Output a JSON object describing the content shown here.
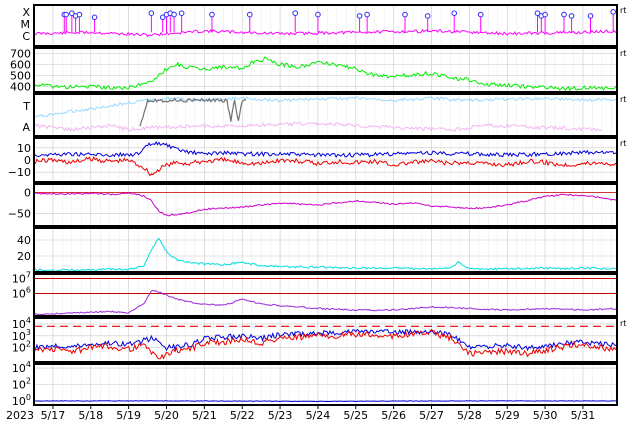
{
  "chart_data": {
    "type": "line",
    "x_axis": {
      "year_label": "2023",
      "ticks": [
        "5/17",
        "5/18",
        "5/19",
        "5/20",
        "5/21",
        "5/22",
        "5/23",
        "5/24",
        "5/25",
        "5/26",
        "5/27",
        "5/28",
        "5/29",
        "5/30",
        "5/31"
      ],
      "start_day": 16.5,
      "end_day": 31.9
    },
    "grid": true,
    "side_label": "rt",
    "panels": [
      {
        "id": "xray-flares",
        "type": "scatter",
        "ytick_labels": [
          "X",
          "M",
          "C"
        ],
        "ylim": [
          0,
          3
        ],
        "line_color": "#ff00ff",
        "marker_color": "#2a2aff",
        "flare_days": [
          17.3,
          17.35,
          17.5,
          17.6,
          17.7,
          18.1,
          19.6,
          19.9,
          20.0,
          20.1,
          20.2,
          20.4,
          21.2,
          22.2,
          23.4,
          24.0,
          25.1,
          25.3,
          26.3,
          26.9,
          27.6,
          28.3,
          29.8,
          29.9,
          30.0,
          30.5,
          30.7,
          31.2,
          31.8
        ],
        "flare_levels": [
          2.3,
          2.3,
          2.4,
          2.2,
          2.3,
          2.1,
          2.4,
          2.1,
          2.3,
          2.4,
          2.3,
          2.4,
          2.3,
          2.3,
          2.4,
          2.3,
          2.2,
          2.3,
          2.3,
          2.2,
          2.4,
          2.3,
          2.4,
          2.2,
          2.3,
          2.3,
          2.2,
          2.2,
          2.5
        ]
      },
      {
        "id": "solar-wind-speed",
        "ylim": [
          350,
          750
        ],
        "yticks": [
          400,
          500,
          600,
          700
        ],
        "series": [
          {
            "color": "#00ee00",
            "x": [
              16.5,
              17.0,
              17.5,
              18.0,
              18.5,
              19.0,
              19.5,
              19.8,
              20.0,
              20.3,
              20.6,
              21.0,
              21.5,
              22.0,
              22.3,
              22.6,
              23.0,
              23.5,
              24.0,
              24.5,
              25.0,
              25.5,
              26.0,
              26.5,
              27.0,
              27.5,
              28.0,
              28.5,
              29.0,
              29.5,
              30.0,
              30.5,
              31.0,
              31.5,
              31.9
            ],
            "y": [
              420,
              400,
              395,
              400,
              390,
              390,
              430,
              500,
              560,
              600,
              570,
              560,
              580,
              560,
              620,
              650,
              600,
              580,
              620,
              600,
              560,
              500,
              490,
              510,
              520,
              480,
              460,
              420,
              410,
              400,
              390,
              380,
              390,
              380,
              390
            ]
          }
        ]
      },
      {
        "id": "imf-sector",
        "ytick_labels": [
          "T",
          "A"
        ],
        "ylim": [
          0,
          1
        ],
        "series": [
          {
            "color": "#9ad8ff",
            "x": [
              16.5,
              19.5,
              20.0,
              21.0,
              22.0,
              23.0,
              24.0,
              25.0,
              26.0,
              27.0,
              28.0,
              29.0,
              30.0,
              31.0,
              31.9
            ],
            "y": [
              0.45,
              0.85,
              0.9,
              0.85,
              0.9,
              0.85,
              0.88,
              0.9,
              0.85,
              0.9,
              0.85,
              0.88,
              0.9,
              0.85,
              0.88
            ]
          },
          {
            "color": "#f2b6f2",
            "x": [
              16.5,
              17.0,
              17.5,
              18.0,
              18.5,
              19.0,
              19.5,
              22.0,
              24.0,
              26.0,
              27.5,
              28.5,
              30.0,
              31.5
            ],
            "y": [
              0.25,
              0.2,
              0.15,
              0.2,
              0.25,
              0.15,
              0.2,
              0.25,
              0.3,
              0.2,
              0.15,
              0.25,
              0.2,
              0.15
            ]
          },
          {
            "color": "#707070",
            "x": [
              19.3,
              19.5,
              19.55,
              21.6,
              21.7,
              21.8,
              21.9,
              22.0,
              22.1
            ],
            "y": [
              0.25,
              0.85,
              0.85,
              0.85,
              0.35,
              0.85,
              0.35,
              0.85,
              0.85
            ]
          }
        ]
      },
      {
        "id": "imf-bt-bz",
        "ylim": [
          -18,
          18
        ],
        "yticks": [
          -10,
          0,
          10
        ],
        "series": [
          {
            "color": "#0000dd",
            "x": [
              16.5,
              17.5,
              18.5,
              19.3,
              19.5,
              19.8,
              20.0,
              20.3,
              20.7,
              21.0,
              21.5,
              22.0,
              23.0,
              24.0,
              25.0,
              26.0,
              27.0,
              28.0,
              29.0,
              30.0,
              31.0,
              31.9
            ],
            "y": [
              4,
              5,
              4,
              5,
              12,
              14,
              12,
              8,
              6,
              5,
              6,
              5,
              5,
              4,
              4,
              5,
              6,
              5,
              4,
              5,
              6,
              6
            ]
          },
          {
            "color": "#ee0000",
            "x": [
              16.5,
              17.0,
              17.5,
              18.0,
              18.5,
              19.0,
              19.4,
              19.6,
              19.8,
              20.0,
              20.3,
              20.6,
              21.0,
              21.5,
              22.0,
              22.5,
              23.0,
              23.5,
              24.0,
              24.5,
              25.0,
              25.5,
              26.0,
              26.5,
              27.0,
              27.5,
              28.0,
              28.5,
              29.0,
              29.5,
              30.0,
              30.5,
              31.0,
              31.5,
              31.9
            ],
            "y": [
              -1,
              0,
              -2,
              1,
              -1,
              0,
              -6,
              -12,
              -8,
              -4,
              -2,
              -3,
              -1,
              0,
              -2,
              -3,
              0,
              -1,
              -3,
              -1,
              -2,
              -1,
              -4,
              -2,
              -1,
              -3,
              -2,
              -3,
              -4,
              -1,
              -2,
              -4,
              -3,
              -2,
              -4
            ]
          }
        ]
      },
      {
        "id": "dst-index",
        "ylim": [
          -80,
          20
        ],
        "yticks": [
          -50,
          0
        ],
        "series": [
          {
            "color": "#cc00cc",
            "x": [
              16.5,
              17.0,
              17.5,
              18.0,
              18.5,
              19.0,
              19.4,
              19.6,
              19.8,
              20.0,
              20.5,
              21.0,
              22.0,
              23.0,
              23.5,
              24.0,
              25.0,
              26.0,
              26.5,
              27.0,
              27.5,
              28.0,
              28.5,
              29.0,
              29.5,
              30.0,
              30.5,
              31.0,
              31.5,
              31.9
            ],
            "y": [
              -2,
              -4,
              -3,
              -2,
              -5,
              -2,
              -8,
              -20,
              -45,
              -55,
              -50,
              -40,
              -35,
              -25,
              -28,
              -30,
              -20,
              -28,
              -25,
              -32,
              -35,
              -38,
              -36,
              -30,
              -20,
              -10,
              -5,
              -8,
              -12,
              -20
            ]
          }
        ]
      },
      {
        "id": "proton-density",
        "ylim": [
          0,
          55
        ],
        "yticks": [
          20,
          40
        ],
        "series": [
          {
            "color": "#00e0e0",
            "x": [
              16.5,
              17.0,
              17.5,
              18.0,
              18.5,
              19.0,
              19.4,
              19.6,
              19.8,
              20.0,
              20.3,
              20.7,
              21.0,
              21.5,
              22.0,
              22.5,
              23.0,
              24.0,
              25.0,
              26.0,
              27.0,
              27.5,
              27.7,
              28.0,
              29.0,
              30.0,
              30.5,
              31.0,
              31.9
            ],
            "y": [
              3,
              2,
              3,
              2,
              4,
              3,
              8,
              28,
              42,
              25,
              15,
              12,
              10,
              9,
              12,
              8,
              7,
              6,
              5,
              5,
              4,
              5,
              12,
              4,
              4,
              5,
              4,
              5,
              4
            ]
          }
        ]
      },
      {
        "id": "proton-flux",
        "scale": "log",
        "ylim": [
          4.5,
          7.3
        ],
        "yticks": [
          6,
          7
        ],
        "ytick_labels": [
          "10^6",
          "10^7"
        ],
        "threshold_color": "#cc0000",
        "series": [
          {
            "color": "#9a2ad8",
            "x": [
              16.5,
              17.5,
              18.5,
              19.0,
              19.4,
              19.6,
              19.8,
              20.0,
              20.3,
              20.7,
              21.0,
              21.5,
              22.0,
              22.5,
              23.0,
              24.0,
              25.0,
              26.0,
              27.0,
              28.0,
              29.0,
              30.0,
              31.0,
              31.9
            ],
            "y": [
              4.6,
              4.7,
              4.8,
              4.7,
              5.3,
              6.2,
              6.1,
              5.9,
              5.6,
              5.4,
              5.3,
              5.2,
              5.6,
              5.3,
              5.2,
              5.0,
              4.9,
              4.9,
              5.1,
              5.0,
              4.9,
              5.0,
              4.9,
              5.0
            ]
          }
        ]
      },
      {
        "id": "electron-flux",
        "scale": "log",
        "ylim": [
          0.8,
          4.5
        ],
        "yticks": [
          2,
          3,
          4
        ],
        "ytick_labels": [
          "10^2",
          "10^3",
          "10^4"
        ],
        "threshold_color": "#ee0000",
        "series": [
          {
            "color": "#0000dd",
            "x": [
              16.5,
              17.0,
              17.5,
              18.0,
              18.5,
              19.0,
              19.4,
              19.6,
              19.8,
              20.0,
              20.3,
              20.7,
              21.0,
              21.5,
              22.0,
              22.5,
              23.0,
              24.0,
              25.0,
              26.0,
              27.0,
              27.5,
              28.0,
              28.5,
              29.0,
              29.5,
              30.0,
              30.5,
              31.0,
              31.5,
              31.9
            ],
            "y": [
              2.0,
              2.2,
              2.1,
              2.3,
              2.4,
              2.3,
              2.6,
              2.8,
              2.5,
              2.0,
              2.1,
              2.3,
              2.8,
              2.9,
              3.0,
              2.8,
              3.1,
              3.2,
              3.4,
              3.3,
              3.4,
              3.1,
              2.0,
              2.1,
              2.2,
              2.0,
              2.1,
              2.4,
              2.5,
              2.3,
              2.2
            ]
          },
          {
            "color": "#ee0000",
            "x": [
              16.5,
              17.0,
              17.5,
              18.0,
              18.5,
              19.0,
              19.4,
              19.6,
              19.8,
              20.0,
              20.3,
              20.7,
              21.0,
              21.5,
              22.0,
              22.5,
              23.0,
              24.0,
              25.0,
              26.0,
              27.0,
              27.5,
              28.0,
              28.5,
              29.0,
              29.5,
              30.0,
              30.5,
              31.0,
              31.5,
              31.9
            ],
            "y": [
              1.8,
              1.9,
              1.7,
              2.0,
              2.1,
              1.9,
              2.2,
              1.6,
              1.2,
              1.4,
              1.8,
              2.0,
              2.4,
              2.5,
              2.7,
              2.4,
              2.8,
              3.0,
              3.1,
              3.0,
              3.3,
              2.8,
              1.5,
              1.6,
              1.7,
              1.5,
              1.8,
              2.1,
              2.3,
              2.0,
              1.8
            ]
          }
        ]
      },
      {
        "id": "bottom-log-panel",
        "scale": "log",
        "ylim": [
          -0.5,
          4.5
        ],
        "yticks": [
          0,
          2,
          4
        ],
        "ytick_labels": [
          "10^0",
          "10^2",
          "10^4"
        ],
        "series": [
          {
            "color": "#0000dd",
            "x": [
              16.5,
              20.0,
              24.0,
              28.0,
              31.9
            ],
            "y": [
              0.0,
              0.0,
              -0.05,
              0.0,
              0.0
            ]
          }
        ]
      }
    ]
  }
}
